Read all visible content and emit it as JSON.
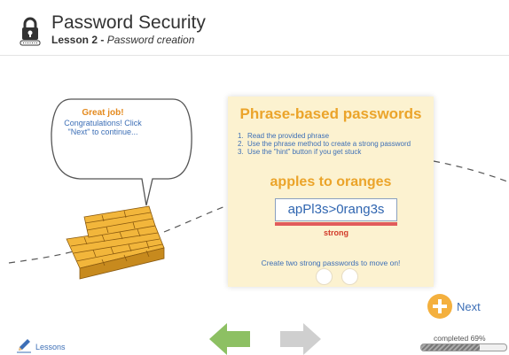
{
  "header": {
    "title": "Password Security",
    "lesson_num": "Lesson 2 - ",
    "lesson_name": "Password creation"
  },
  "bubble": {
    "title": "Great job!",
    "message": "Congratulations! Click \"Next\" to continue..."
  },
  "panel": {
    "title": "Phrase-based passwords",
    "steps": [
      {
        "num": "1.",
        "text": "Read the provided phrase"
      },
      {
        "num": "2.",
        "text": "Use the phrase method to create a strong password"
      },
      {
        "num": "3.",
        "text": "Use the \"hint\" button if you get stuck"
      }
    ],
    "phrase": "apples to oranges",
    "password_value": "apPl3s>0rang3s",
    "strength_label": "strong",
    "strength_color": "#e15b5b",
    "note": "Create two strong passwords to move on!"
  },
  "next_label": "Next",
  "footer": {
    "lessons_label": "Lessons",
    "completed_label": "completed 69%",
    "progress_fraction": 0.69
  },
  "icons": [
    "lock-icon",
    "pencil-icon",
    "plus-icon",
    "arrow-left-icon",
    "arrow-right-icon"
  ],
  "colors": {
    "accent_orange": "#eba42a",
    "text_blue": "#3d6fb6",
    "panel_bg": "#fcf2d0",
    "back_green": "#8dc063",
    "forward_gray": "#cfcfcf"
  }
}
